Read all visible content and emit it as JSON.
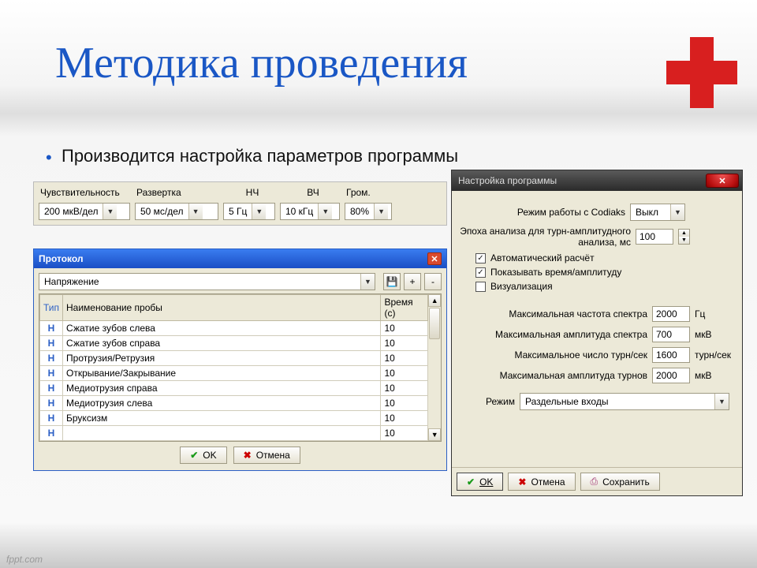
{
  "slide": {
    "title": "Методика проведения",
    "bullet": "Производится настройка параметров программы",
    "watermark": "fppt.com"
  },
  "toolbar": {
    "labels": {
      "sensitivity": "Чувствительность",
      "sweep": "Развертка",
      "lf": "НЧ",
      "hf": "ВЧ",
      "volume": "Гром."
    },
    "values": {
      "sensitivity": "200 мкВ/дел",
      "sweep": "50 мс/дел",
      "lf": "5 Гц",
      "hf": "10 кГц",
      "volume": "80%"
    }
  },
  "protocol": {
    "title": "Протокол",
    "mode": "Напряжение",
    "columns": {
      "type": "Тип",
      "name": "Наименование пробы",
      "time": "Время (с)"
    },
    "rows": [
      {
        "type": "Н",
        "name": "Сжатие зубов слева",
        "time": "10"
      },
      {
        "type": "Н",
        "name": "Сжатие зубов справа",
        "time": "10"
      },
      {
        "type": "Н",
        "name": "Протрузия/Ретрузия",
        "time": "10"
      },
      {
        "type": "Н",
        "name": "Открывание/Закрывание",
        "time": "10"
      },
      {
        "type": "Н",
        "name": "Медиотрузия справа",
        "time": "10"
      },
      {
        "type": "Н",
        "name": "Медиотрузия слева",
        "time": "10"
      },
      {
        "type": "Н",
        "name": "Бруксизм",
        "time": "10"
      },
      {
        "type": "Н",
        "name": "",
        "time": "10"
      }
    ],
    "ok": "OK",
    "cancel": "Отмена"
  },
  "settings": {
    "title": "Настройка программы",
    "codiaks_label": "Режим работы с Codiaks",
    "codiaks_value": "Выкл",
    "epoch_label": "Эпоха анализа для турн-амплитудного анализа, мс",
    "epoch_value": "100",
    "check_auto": "Автоматический расчёт",
    "check_time": "Показывать время/амплитуду",
    "check_visual": "Визуализация",
    "max_freq_label": "Максимальная частота спектра",
    "max_freq_value": "2000",
    "max_freq_unit": "Гц",
    "max_amp_label": "Максимальная амплитуда спектра",
    "max_amp_value": "700",
    "max_amp_unit": "мкВ",
    "max_turns_label": "Максимальное число турн/сек",
    "max_turns_value": "1600",
    "max_turns_unit": "турн/сек",
    "max_turn_amp_label": "Максимальная амплитуда турнов",
    "max_turn_amp_value": "2000",
    "max_turn_amp_unit": "мкВ",
    "mode_label": "Режим",
    "mode_value": "Раздельные входы",
    "ok": "OK",
    "cancel": "Отмена",
    "save": "Сохранить"
  }
}
